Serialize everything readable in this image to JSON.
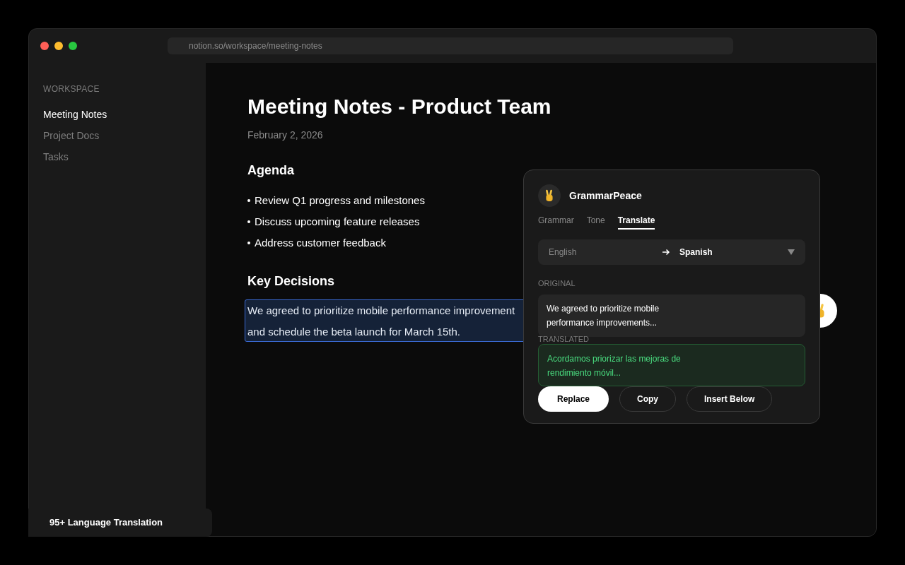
{
  "window": {
    "url": "notion.so/workspace/meeting-notes"
  },
  "sidebar": {
    "heading": "WORKSPACE",
    "items": [
      {
        "label": "Meeting Notes",
        "selected": true
      },
      {
        "label": "Project Docs",
        "selected": false
      },
      {
        "label": "Tasks",
        "selected": false
      }
    ]
  },
  "page": {
    "title": "Meeting Notes - Product Team",
    "date": "February 2, 2026",
    "sections": [
      {
        "heading": "Agenda",
        "kind": "bullets",
        "items": [
          "Review Q1 progress and milestones",
          "Discuss upcoming feature releases",
          "Address customer feedback"
        ]
      },
      {
        "heading": "Key Decisions",
        "kind": "selected-paragraph",
        "items": [
          "We agreed to prioritize mobile performance improvement",
          "and schedule the beta launch for March 15th."
        ]
      }
    ]
  },
  "popup": {
    "name": "GrammarPeace",
    "tabs": [
      {
        "label": "Grammar",
        "selected": false
      },
      {
        "label": "Tone",
        "selected": false
      },
      {
        "label": "Translate",
        "selected": true
      }
    ],
    "from": "English",
    "to": "Spanish",
    "original_label": "ORIGINAL",
    "original": "We agreed to prioritize mobile\nperformance improvements...",
    "translated_label": "TRANSLATED",
    "translated": "Acordamos priorizar las mejoras de\nrendimiento móvil...",
    "buttons": [
      {
        "label": "Replace",
        "kind": "primary"
      },
      {
        "label": "Copy",
        "kind": "outline"
      },
      {
        "label": "Insert Below",
        "kind": "outline"
      }
    ]
  },
  "feature_badge": "95+ Language Translation"
}
